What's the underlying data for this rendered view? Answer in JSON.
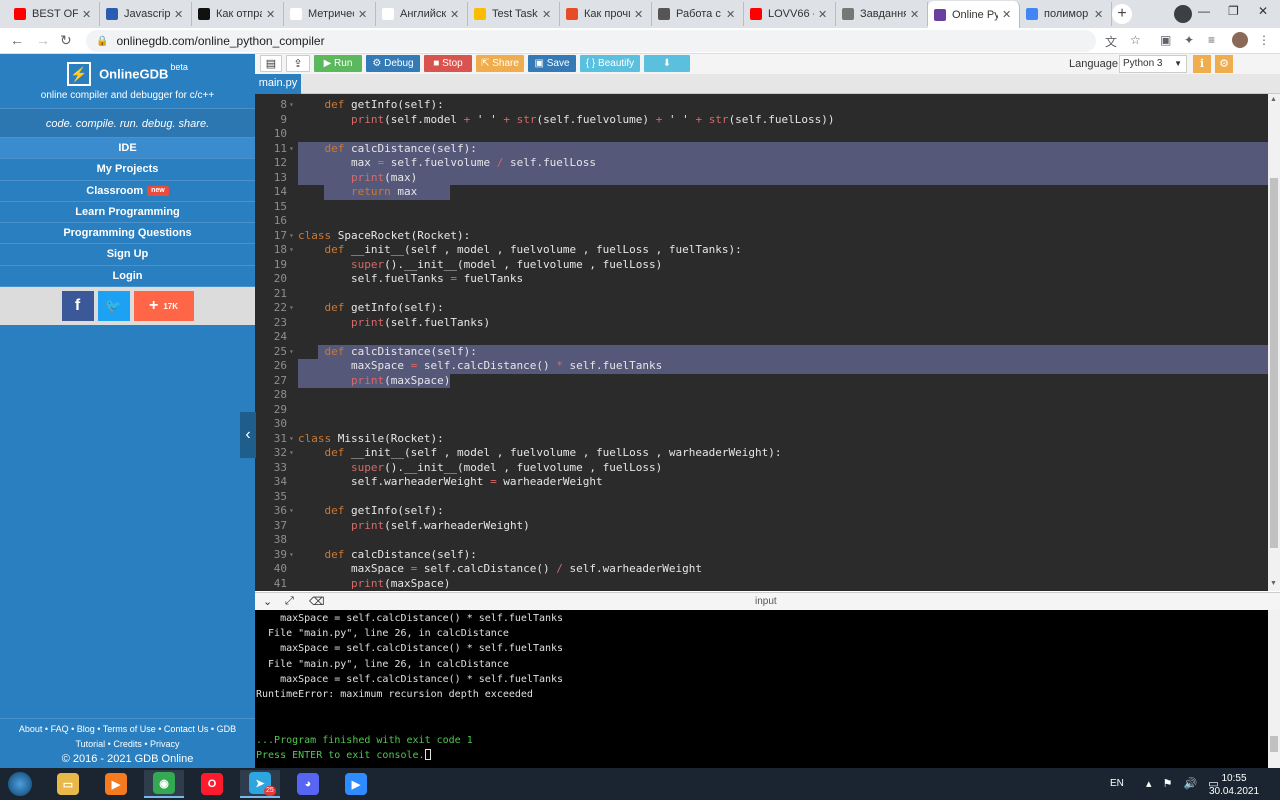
{
  "browser": {
    "tabs": [
      {
        "title": "BEST OF S",
        "icon": "youtube-icon",
        "color": "#ff0000"
      },
      {
        "title": "Javascript",
        "icon": "bold-b-icon",
        "color": "#2a5db0"
      },
      {
        "title": "Как отпра",
        "icon": "k-letter-icon",
        "color": "#111111"
      },
      {
        "title": "Метричес",
        "icon": "wikipedia-icon",
        "color": "#ffffff"
      },
      {
        "title": "Английск",
        "icon": "wikipedia-icon",
        "color": "#ffffff"
      },
      {
        "title": "Test Tasks",
        "icon": "google-drive-icon",
        "color": "#fbbc04"
      },
      {
        "title": "Как прочи",
        "icon": "code-icon",
        "color": "#e44d26"
      },
      {
        "title": "Работа с с",
        "icon": "window-icon",
        "color": "#555555"
      },
      {
        "title": "LOVV66 -",
        "icon": "youtube-icon",
        "color": "#ff0000"
      },
      {
        "title": "Завдання",
        "icon": "globe-icon",
        "color": "#777777"
      },
      {
        "title": "Online Pyt",
        "icon": "lightning-icon",
        "color": "#6a3fa0"
      },
      {
        "title": "полимор",
        "icon": "google-icon",
        "color": "#4285f4"
      }
    ],
    "active_tab_index": 10,
    "url": "onlinegdb.com/online_python_compiler"
  },
  "sidebar": {
    "brand": "OnlineGDB",
    "beta": "beta",
    "subtitle": "online compiler and debugger for c/c++",
    "tagline": "code. compile. run. debug. share.",
    "nav": [
      {
        "label": "IDE",
        "active": true
      },
      {
        "label": "My Projects"
      },
      {
        "label": "Classroom",
        "badge": "new"
      },
      {
        "label": "Learn Programming"
      },
      {
        "label": "Programming Questions"
      },
      {
        "label": "Sign Up"
      },
      {
        "label": "Login"
      }
    ],
    "share_count": "17K",
    "footer_links": "About • FAQ • Blog • Terms of Use • Contact Us • GDB",
    "footer_links2": "Tutorial • Credits • Privacy",
    "copyright": "© 2016 - 2021 GDB Online"
  },
  "toolbar": {
    "run": "Run",
    "debug": "Debug",
    "stop": "Stop",
    "share": "Share",
    "save": "Save",
    "beautify": "{ } Beautify",
    "language_label": "Language",
    "language": "Python 3",
    "colors": {
      "run": "#5cb85c",
      "debug": "#337ab7",
      "stop": "#d9534f",
      "share": "#f0ad4e",
      "save": "#337ab7",
      "beautify": "#5bc0de",
      "download": "#5bc0de"
    }
  },
  "file_tab": "main.py",
  "editor": {
    "lines": [
      {
        "n": 8,
        "fold": true,
        "text": "    def getInfo(self):"
      },
      {
        "n": 9,
        "text": "        print(self.model + ' ' + str(self.fuelvolume) + ' ' + str(self.fuelLoss))"
      },
      {
        "n": 10,
        "text": ""
      },
      {
        "n": 11,
        "fold": true,
        "text": "    def calcDistance(self):"
      },
      {
        "n": 12,
        "text": "        max = self.fuelvolume / self.fuelLoss"
      },
      {
        "n": 13,
        "text": "        print(max)"
      },
      {
        "n": 14,
        "text": "        return max"
      },
      {
        "n": 15,
        "text": ""
      },
      {
        "n": 16,
        "text": ""
      },
      {
        "n": 17,
        "fold": true,
        "text": "class SpaceRocket(Rocket):"
      },
      {
        "n": 18,
        "fold": true,
        "text": "    def __init__(self , model , fuelvolume , fuelLoss , fuelTanks):"
      },
      {
        "n": 19,
        "text": "        super().__init__(model , fuelvolume , fuelLoss)"
      },
      {
        "n": 20,
        "text": "        self.fuelTanks = fuelTanks"
      },
      {
        "n": 21,
        "text": ""
      },
      {
        "n": 22,
        "fold": true,
        "text": "    def getInfo(self):"
      },
      {
        "n": 23,
        "text": "        print(self.fuelTanks)"
      },
      {
        "n": 24,
        "text": ""
      },
      {
        "n": 25,
        "fold": true,
        "text": "    def calcDistance(self):"
      },
      {
        "n": 26,
        "text": "        maxSpace = self.calcDistance() * self.fuelTanks"
      },
      {
        "n": 27,
        "text": "        print(maxSpace)"
      },
      {
        "n": 28,
        "text": ""
      },
      {
        "n": 29,
        "text": ""
      },
      {
        "n": 30,
        "text": ""
      },
      {
        "n": 31,
        "fold": true,
        "text": "class Missile(Rocket):"
      },
      {
        "n": 32,
        "fold": true,
        "text": "    def __init__(self , model , fuelvolume , fuelLoss , warheaderWeight):"
      },
      {
        "n": 33,
        "text": "        super().__init__(model , fuelvolume , fuelLoss)"
      },
      {
        "n": 34,
        "text": "        self.warheaderWeight = warheaderWeight"
      },
      {
        "n": 35,
        "text": ""
      },
      {
        "n": 36,
        "fold": true,
        "text": "    def getInfo(self):"
      },
      {
        "n": 37,
        "text": "        print(self.warheaderWeight)"
      },
      {
        "n": 38,
        "text": ""
      },
      {
        "n": 39,
        "fold": true,
        "text": "    def calcDistance(self):"
      },
      {
        "n": 40,
        "text": "        maxSpace = self.calcDistance() / self.warheaderWeight"
      },
      {
        "n": 41,
        "text": "        print(maxSpace)"
      }
    ],
    "selection_color": "#56587a"
  },
  "console": {
    "title": "input",
    "lines": [
      {
        "text": "    maxSpace = self.calcDistance() * self.fuelTanks"
      },
      {
        "text": "  File \"main.py\", line 26, in calcDistance"
      },
      {
        "text": "    maxSpace = self.calcDistance() * self.fuelTanks"
      },
      {
        "text": "  File \"main.py\", line 26, in calcDistance"
      },
      {
        "text": "    maxSpace = self.calcDistance() * self.fuelTanks"
      },
      {
        "text": "RuntimeError: maximum recursion depth exceeded"
      },
      {
        "text": ""
      },
      {
        "text": ""
      },
      {
        "text": "...Program finished with exit code 1",
        "green": true
      },
      {
        "text": "Press ENTER to exit console.",
        "green": true,
        "cursor": true
      }
    ]
  },
  "taskbar": {
    "apps": [
      {
        "name": "file-explorer-icon",
        "color": "#e8b84a",
        "open": false
      },
      {
        "name": "media-player-icon",
        "color": "#f47b20",
        "open": false
      },
      {
        "name": "chrome-icon",
        "color": "#34a853",
        "open": true
      },
      {
        "name": "opera-icon",
        "color": "#ff1b2d",
        "open": false
      },
      {
        "name": "telegram-icon",
        "color": "#2ca5e0",
        "open": true,
        "badge": "25"
      },
      {
        "name": "discord-icon",
        "color": "#5865f2",
        "open": false
      },
      {
        "name": "zoom-icon",
        "color": "#2d8cff",
        "open": false
      }
    ],
    "lang": "EN",
    "time": "10:55",
    "date": "30.04.2021"
  }
}
